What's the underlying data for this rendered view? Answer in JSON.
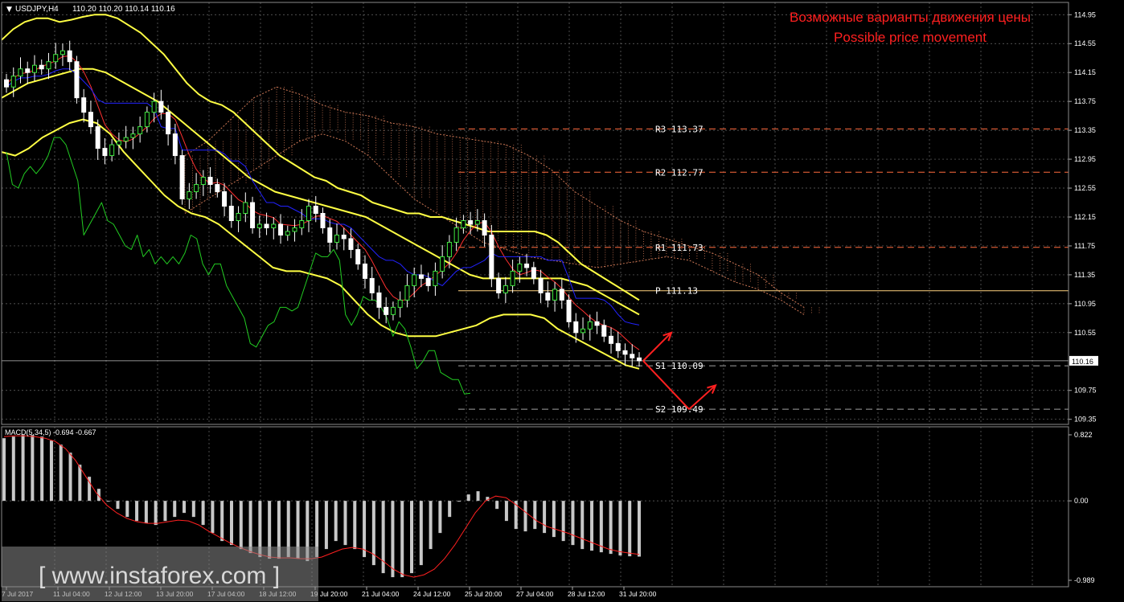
{
  "header": {
    "symbol_timeframe": "USDJPY,H4",
    "ohlc": "110.20 110.20 110.14 110.16"
  },
  "annotation": {
    "line_ru": "Возможные варианты движения цены",
    "line_en": "Possible price movement"
  },
  "watermark": "[ www.instaforex.com ]",
  "colors": {
    "background": "#000000",
    "grid": "#6b6b6b",
    "bull_candle": "#ffffff",
    "bear_candle": "#ffffff",
    "envelope": "#ffff44",
    "tenkan": "#ff3030",
    "kijun": "#2222ff",
    "chikou": "#22cc22",
    "kumo": "#cc7755",
    "pivot_line": "#ff6a3d",
    "annotation": "#ff2020",
    "macd_hist": "#c8c8c8",
    "macd_signal": "#ff2020"
  },
  "chart_data": [
    {
      "type": "candlestick",
      "symbol": "USDJPY",
      "timeframe": "H4",
      "y_ticks": [
        "114.95",
        "114.55",
        "114.15",
        "113.75",
        "113.35",
        "112.95",
        "112.55",
        "112.15",
        "111.75",
        "111.35",
        "110.95",
        "110.55",
        "110.16",
        "109.75",
        "109.35"
      ],
      "ylim": [
        109.28,
        115.12
      ],
      "x_ticks": [
        "7 Jul 2017",
        "11 Jul 04:00",
        "12 Jul 12:00",
        "13 Jul 20:00",
        "17 Jul 04:00",
        "18 Jul 12:00",
        "19 Jul 20:00",
        "21 Jul 04:00",
        "24 Jul 12:00",
        "25 Jul 20:00",
        "27 Jul 04:00",
        "28 Jul 12:00",
        "31 Jul 20:00"
      ],
      "current_price": "110.16",
      "closes": [
        113.95,
        114.1,
        114.2,
        114.15,
        114.25,
        114.2,
        114.3,
        114.4,
        114.45,
        114.3,
        113.8,
        113.6,
        113.4,
        113.1,
        113.0,
        113.15,
        113.2,
        113.25,
        113.3,
        113.4,
        113.6,
        113.75,
        113.6,
        113.3,
        113.0,
        112.4,
        112.5,
        112.6,
        112.7,
        112.6,
        112.5,
        112.3,
        112.1,
        112.2,
        112.35,
        112.0,
        112.05,
        112.0,
        112.05,
        111.9,
        111.95,
        112.0,
        112.1,
        112.3,
        112.2,
        112.0,
        111.8,
        111.9,
        111.85,
        111.7,
        111.5,
        111.3,
        111.1,
        110.9,
        110.8,
        110.9,
        111.0,
        111.2,
        111.35,
        111.3,
        111.2,
        111.4,
        111.6,
        111.8,
        112.0,
        112.1,
        112.05,
        112.1,
        111.9,
        111.3,
        111.1,
        111.2,
        111.4,
        111.5,
        111.45,
        111.3,
        111.1,
        111.0,
        111.15,
        111.0,
        110.7,
        110.55,
        110.6,
        110.7,
        110.65,
        110.5,
        110.4,
        110.3,
        110.25,
        110.2,
        110.16
      ],
      "envelope_upper": [
        114.6,
        114.75,
        114.85,
        114.9,
        114.9,
        114.85,
        114.88,
        114.92,
        114.95,
        114.95,
        114.9,
        114.8,
        114.7,
        114.55,
        114.4,
        114.2,
        114.0,
        113.85,
        113.75,
        113.7,
        113.6,
        113.45,
        113.3,
        113.15,
        113.0,
        112.9,
        112.8,
        112.7,
        112.65,
        112.55,
        112.5,
        112.45,
        112.35,
        112.3,
        112.25,
        112.2,
        112.2,
        112.15,
        112.15,
        112.1,
        112.05,
        112.0,
        111.95,
        111.95,
        111.95,
        111.95,
        111.95,
        111.9,
        111.8,
        111.65,
        111.5,
        111.4,
        111.3,
        111.2,
        111.1,
        111.0
      ],
      "envelope_middle": [
        113.8,
        113.9,
        114.0,
        114.05,
        114.1,
        114.15,
        114.2,
        114.2,
        114.15,
        114.05,
        113.95,
        113.85,
        113.75,
        113.6,
        113.45,
        113.3,
        113.15,
        113.0,
        112.85,
        112.7,
        112.6,
        112.5,
        112.45,
        112.4,
        112.35,
        112.3,
        112.25,
        112.2,
        112.15,
        112.05,
        111.95,
        111.85,
        111.75,
        111.65,
        111.55,
        111.45,
        111.35,
        111.3,
        111.3,
        111.3,
        111.3,
        111.3,
        111.3,
        111.3,
        111.25,
        111.2,
        111.1,
        111.0,
        110.9,
        110.8
      ],
      "envelope_lower": [
        113.05,
        113.0,
        113.1,
        113.25,
        113.35,
        113.45,
        113.5,
        113.45,
        113.3,
        113.05,
        112.85,
        112.65,
        112.45,
        112.3,
        112.2,
        112.15,
        112.05,
        111.9,
        111.75,
        111.6,
        111.45,
        111.4,
        111.4,
        111.35,
        111.3,
        111.2,
        111.0,
        110.8,
        110.65,
        110.55,
        110.5,
        110.5,
        110.5,
        110.55,
        110.6,
        110.65,
        110.75,
        110.8,
        110.8,
        110.8,
        110.75,
        110.6,
        110.5,
        110.4,
        110.3,
        110.2,
        110.1,
        110.05
      ],
      "kumo_top": [
        113.0,
        113.2,
        113.5,
        113.8,
        113.95,
        113.85,
        113.7,
        113.6,
        113.55,
        113.45,
        113.4,
        113.3,
        113.25,
        113.2,
        113.15,
        113.0,
        112.8,
        112.5,
        112.3,
        112.1,
        111.95,
        111.85,
        111.75,
        111.65,
        111.5,
        111.35,
        111.1,
        110.9
      ],
      "kumo_bottom": [
        112.2,
        112.4,
        112.6,
        112.8,
        113.0,
        113.2,
        113.3,
        113.2,
        113.0,
        112.7,
        112.4,
        112.2,
        112.0,
        111.8,
        111.7,
        111.6,
        111.55,
        111.5,
        111.45,
        111.5,
        111.55,
        111.6,
        111.55,
        111.4,
        111.25,
        111.15,
        111.0,
        110.8
      ],
      "pivot_levels": [
        {
          "label": "R3",
          "value": "113.37"
        },
        {
          "label": "R2",
          "value": "112.77"
        },
        {
          "label": "R1",
          "value": "111.73"
        },
        {
          "label": "P",
          "value": "111.13"
        },
        {
          "label": "S1",
          "value": "110.09"
        },
        {
          "label": "S2",
          "value": "109.49"
        }
      ]
    },
    {
      "type": "bar",
      "indicator": "MACD(5,34,5)",
      "label": "MACD(5,34,5) -0.694 -0.667",
      "y_ticks": [
        "0.822",
        "0.00",
        "-0.989"
      ],
      "ylim": [
        -0.989,
        0.822
      ],
      "histogram": [
        0.78,
        0.8,
        0.82,
        0.82,
        0.8,
        0.75,
        0.7,
        0.6,
        0.45,
        0.3,
        0.15,
        0.0,
        -0.1,
        -0.2,
        -0.25,
        -0.28,
        -0.3,
        -0.25,
        -0.2,
        -0.15,
        -0.2,
        -0.3,
        -0.4,
        -0.5,
        -0.55,
        -0.6,
        -0.65,
        -0.7,
        -0.72,
        -0.72,
        -0.7,
        -0.72,
        -0.75,
        -0.7,
        -0.6,
        -0.5,
        -0.55,
        -0.6,
        -0.7,
        -0.8,
        -0.9,
        -0.95,
        -0.95,
        -0.9,
        -0.8,
        -0.6,
        -0.4,
        -0.2,
        0.0,
        0.08,
        0.12,
        0.05,
        -0.1,
        -0.25,
        -0.35,
        -0.38,
        -0.35,
        -0.4,
        -0.45,
        -0.5,
        -0.55,
        -0.6,
        -0.62,
        -0.64,
        -0.66,
        -0.68,
        -0.69,
        -0.694
      ],
      "signal": [
        0.8,
        0.81,
        0.81,
        0.8,
        0.78,
        0.74,
        0.65,
        0.5,
        0.3,
        0.1,
        -0.05,
        -0.15,
        -0.22,
        -0.26,
        -0.28,
        -0.28,
        -0.26,
        -0.24,
        -0.25,
        -0.3,
        -0.38,
        -0.45,
        -0.52,
        -0.58,
        -0.63,
        -0.67,
        -0.7,
        -0.71,
        -0.71,
        -0.72,
        -0.72,
        -0.7,
        -0.65,
        -0.6,
        -0.58,
        -0.6,
        -0.66,
        -0.75,
        -0.85,
        -0.92,
        -0.95,
        -0.92,
        -0.85,
        -0.72,
        -0.55,
        -0.35,
        -0.15,
        0.0,
        0.06,
        0.04,
        -0.05,
        -0.15,
        -0.25,
        -0.32,
        -0.36,
        -0.4,
        -0.45,
        -0.5,
        -0.55,
        -0.6,
        -0.63,
        -0.65,
        -0.667
      ]
    }
  ]
}
